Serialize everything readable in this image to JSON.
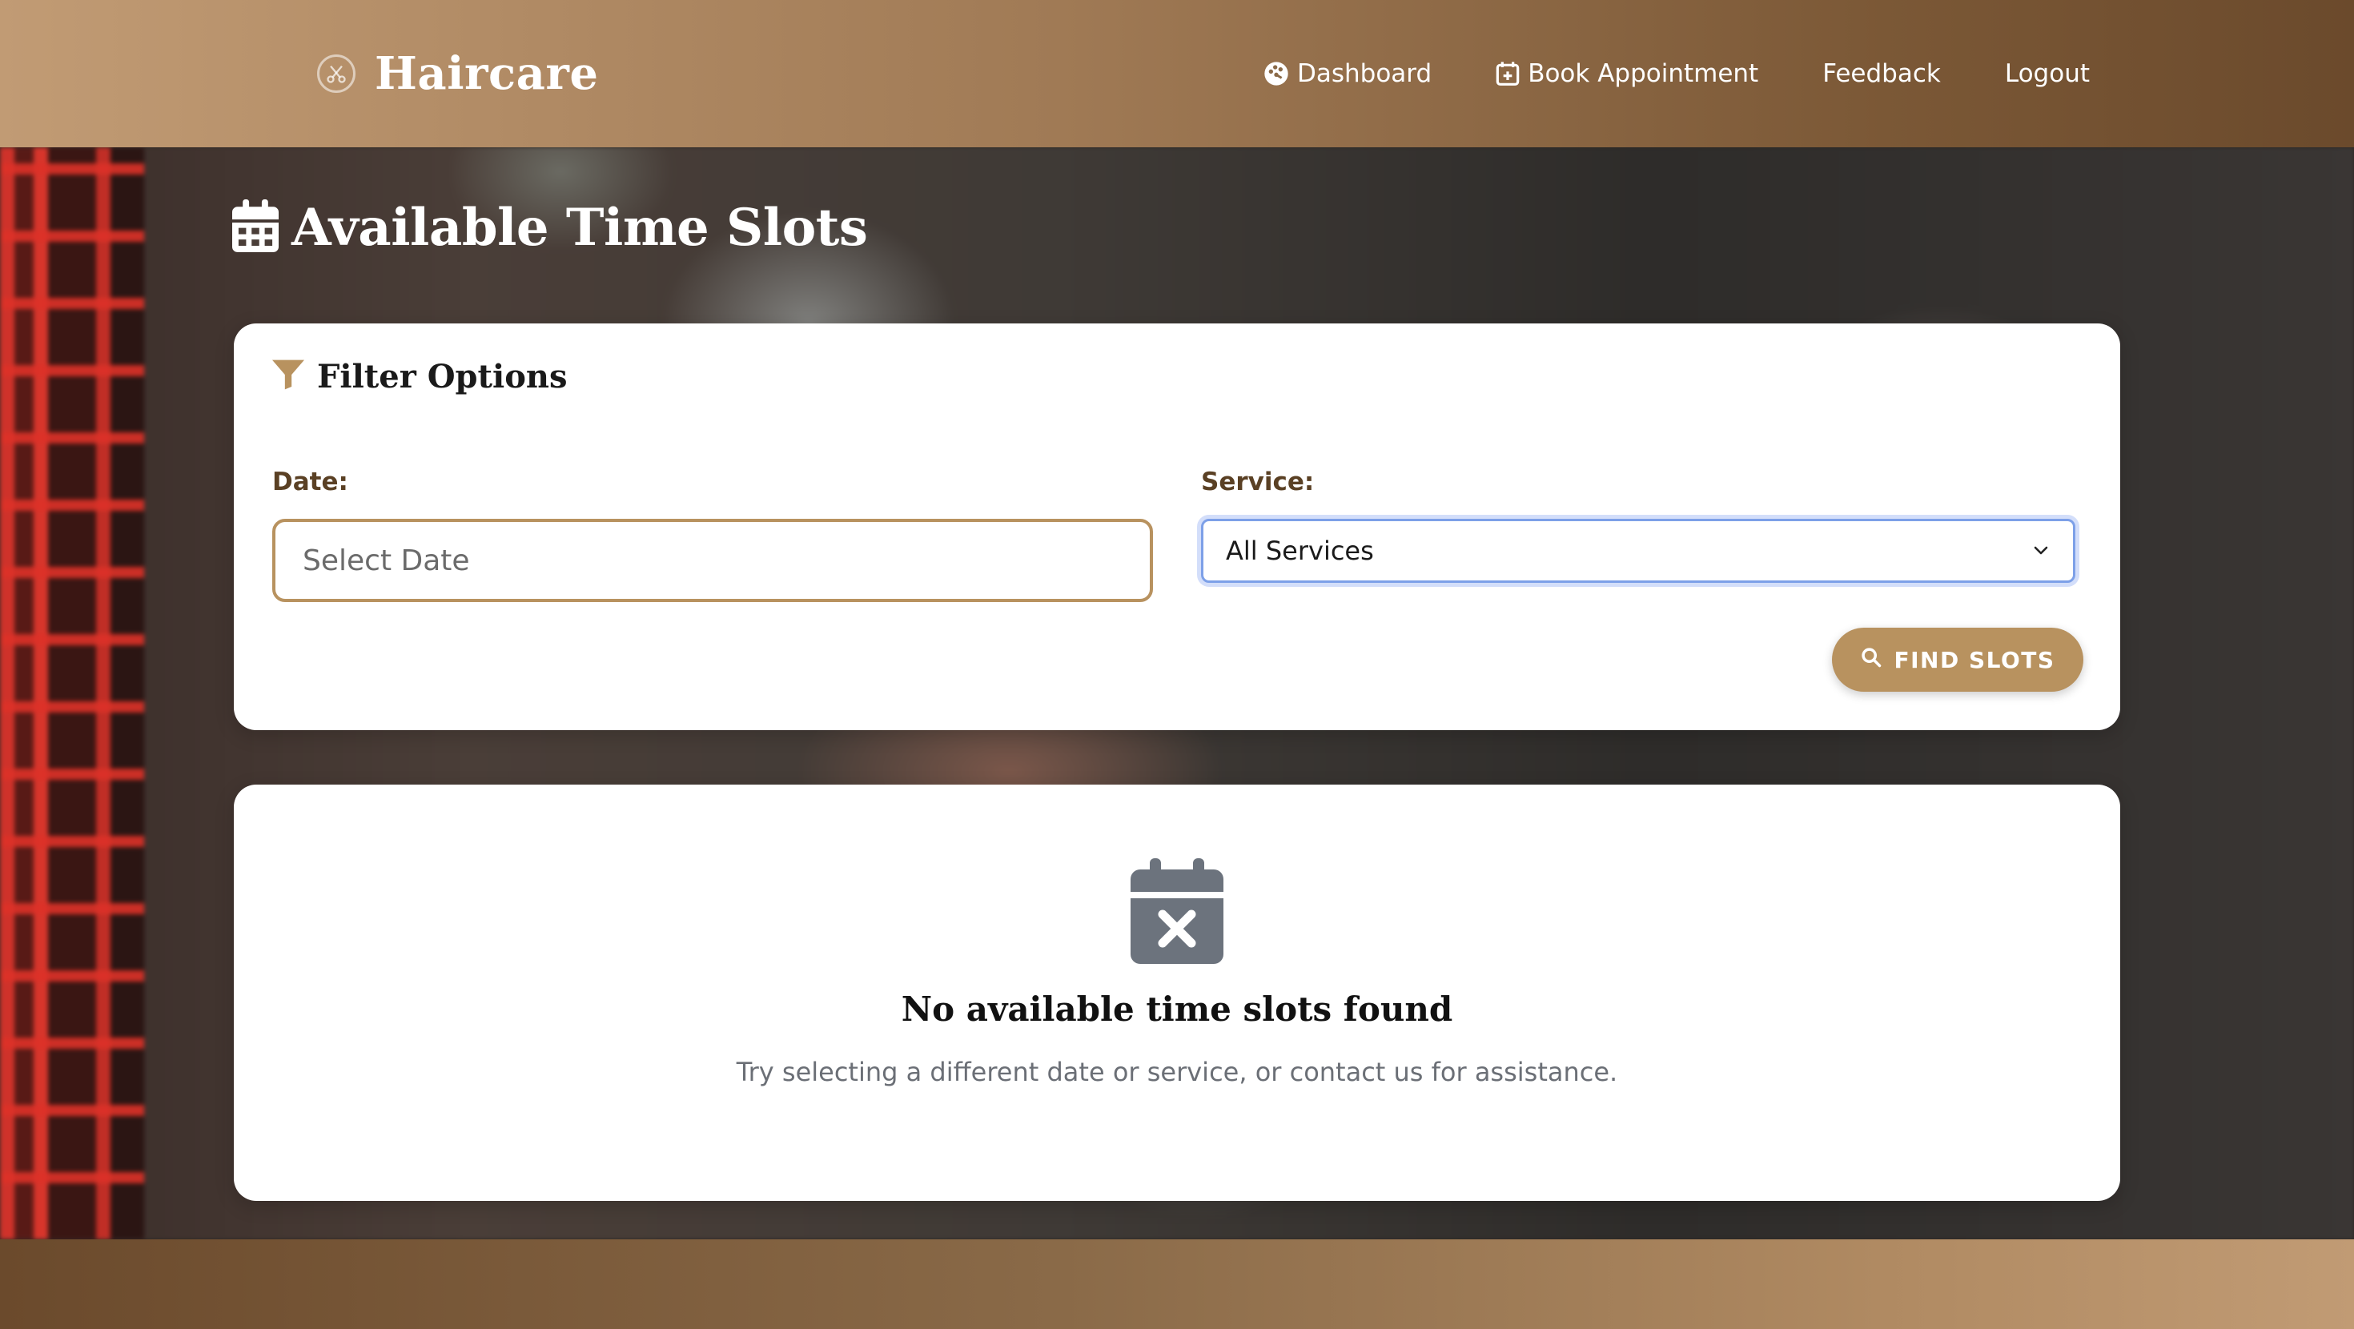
{
  "brand": {
    "name": "Haircare",
    "icon": "scissors-icon"
  },
  "nav": {
    "items": [
      {
        "label": "Dashboard",
        "icon": "palette-icon"
      },
      {
        "label": "Book Appointment",
        "icon": "calendar-plus-icon"
      },
      {
        "label": "Feedback",
        "icon": ""
      },
      {
        "label": "Logout",
        "icon": ""
      }
    ]
  },
  "page": {
    "title": "Available Time Slots",
    "title_icon": "calendar-icon"
  },
  "filter": {
    "title": "Filter Options",
    "title_icon": "filter-icon",
    "date_label": "Date:",
    "date_placeholder": "Select Date",
    "date_value": "",
    "service_label": "Service:",
    "service_selected": "All Services",
    "find_button": "FIND SLOTS"
  },
  "empty_state": {
    "icon": "calendar-x-icon",
    "title": "No available time slots found",
    "message": "Try selecting a different date or service, or contact us for assistance."
  },
  "colors": {
    "accent": "#b8925f",
    "header_start": "#c19b74",
    "header_end": "#6b4a2c",
    "label": "#5a4024",
    "muted_text": "#6b6f76",
    "select_focus": "#7da0e8"
  }
}
